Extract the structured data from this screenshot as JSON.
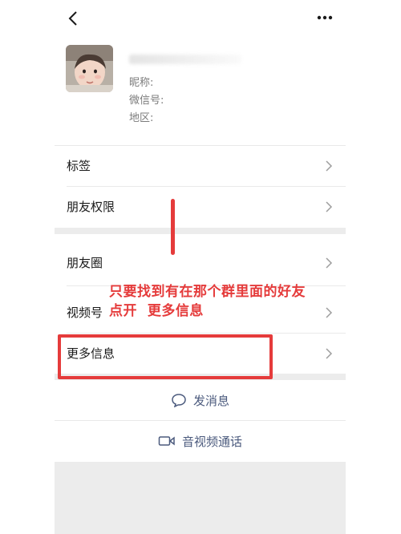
{
  "profile": {
    "nickname_label": "昵称:",
    "wechat_id_label": "微信号:",
    "region_label": "地区:"
  },
  "rows": {
    "tags": "标签",
    "permissions": "朋友权限",
    "moments": "朋友圈",
    "channels": "视频号",
    "more_info": "更多信息"
  },
  "actions": {
    "send_message": "发消息",
    "av_call": "音视频通话"
  },
  "annotation": {
    "line1": "只要找到有在那个群里面的好友",
    "line2": "点开  更多信息"
  },
  "colors": {
    "annotation": "#e53b3b",
    "action_text": "#4b5a7d",
    "gap": "#ececec"
  }
}
